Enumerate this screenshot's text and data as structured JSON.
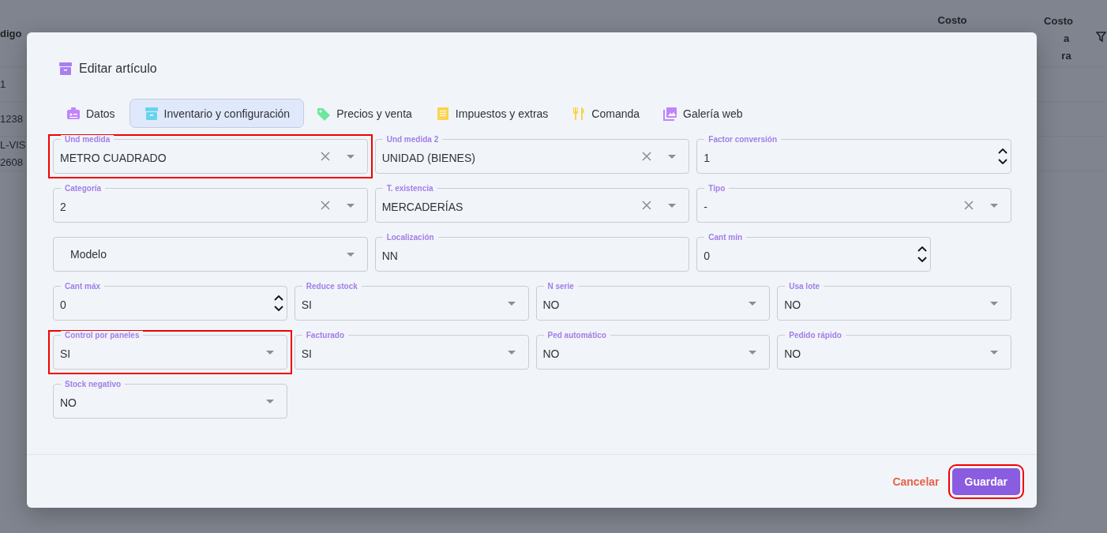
{
  "background_table": {
    "columns": [
      "digo",
      "Costo",
      [
        "Costo",
        "a",
        "ra"
      ]
    ],
    "rows": [
      [
        "1"
      ],
      [
        "1238"
      ],
      [
        "L-VIS 2608"
      ]
    ]
  },
  "dialog": {
    "title": "Editar artículo",
    "tabs": [
      {
        "label": "Datos",
        "color": "#c084fc",
        "selected": false
      },
      {
        "label": "Inventario y configuración",
        "color": "#67d4ee",
        "selected": true
      },
      {
        "label": "Precios y venta",
        "color": "#6ee7a0",
        "selected": false
      },
      {
        "label": "Impuestos y extras",
        "color": "#fcd34d",
        "selected": false
      },
      {
        "label": "Comanda",
        "color": "#fcd34d",
        "selected": false
      },
      {
        "label": "Galería web",
        "color": "#c084fc",
        "selected": false
      }
    ],
    "rows": [
      [
        {
          "kind": "select",
          "label": "Und medida",
          "value": "METRO CUADRADO",
          "clearable": true,
          "highlighted": true
        },
        {
          "kind": "select",
          "label": "Und medida 2",
          "value": "UNIDAD (BIENES)",
          "clearable": true,
          "highlighted": false
        },
        {
          "kind": "number",
          "label": "Factor conversión",
          "value": "1",
          "highlighted": false
        }
      ],
      [
        {
          "kind": "select",
          "label": "Categoría",
          "value": "2",
          "clearable": true,
          "highlighted": false
        },
        {
          "kind": "select",
          "label": "T. existencia",
          "value": "MERCADERÍAS",
          "clearable": true,
          "highlighted": false
        },
        {
          "kind": "select",
          "label": "Tipo",
          "value": "-",
          "clearable": true,
          "highlighted": false
        }
      ],
      [
        {
          "kind": "select",
          "placeholder": "Modelo",
          "clearable": false,
          "highlighted": false
        },
        {
          "kind": "text",
          "label": "Localización",
          "value": "NN",
          "highlighted": false
        },
        {
          "kind": "number",
          "label": "Cant mín",
          "value": "0",
          "highlighted": false
        }
      ],
      [
        {
          "kind": "number",
          "label": "Cant máx",
          "value": "0",
          "highlighted": false
        },
        {
          "kind": "select",
          "label": "Reduce stock",
          "value": "SI",
          "clearable": false,
          "highlighted": false
        },
        {
          "kind": "select",
          "label": "N serie",
          "value": "NO",
          "clearable": false,
          "highlighted": false
        },
        {
          "kind": "select",
          "label": "Usa lote",
          "value": "NO",
          "clearable": false,
          "highlighted": false
        }
      ],
      [
        {
          "kind": "select",
          "label": "Control por paneles",
          "value": "SI",
          "clearable": false,
          "highlighted": true
        },
        {
          "kind": "select",
          "label": "Facturado",
          "value": "SI",
          "clearable": false,
          "highlighted": false
        },
        {
          "kind": "select",
          "label": "Ped automático",
          "value": "NO",
          "clearable": false,
          "highlighted": false
        },
        {
          "kind": "select",
          "label": "Pedido rápido",
          "value": "NO",
          "clearable": false,
          "highlighted": false
        }
      ],
      [
        {
          "kind": "select",
          "label": "Stock negativo",
          "value": "NO",
          "clearable": false,
          "highlighted": false
        }
      ]
    ],
    "cancel_button": {
      "label": "Cancelar"
    },
    "save_button": {
      "label": "Guardar",
      "highlighted": true
    }
  }
}
